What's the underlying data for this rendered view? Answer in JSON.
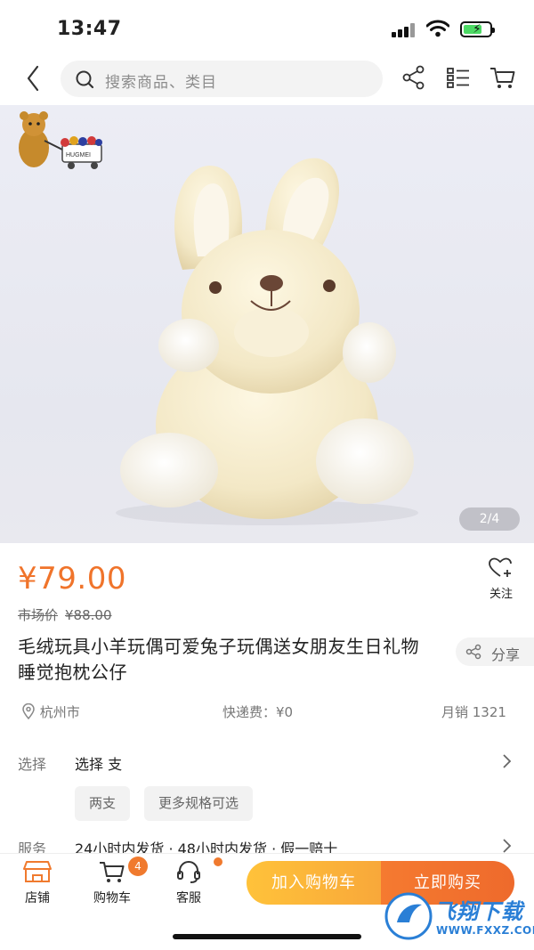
{
  "status_bar": {
    "time": "13:47"
  },
  "nav": {
    "search_placeholder": "搜索商品、类目"
  },
  "hero": {
    "counter": "2/4",
    "logo_text": "HUGMEI"
  },
  "product": {
    "price": "¥79.00",
    "market_label": "市场价",
    "market_price": "¥88.00",
    "follow_label": "关注",
    "title": "毛绒玩具小羊玩偶可爱兔子玩偶送女朋友生日礼物睡觉抱枕公仔",
    "share_label": "分享",
    "location": "杭州市",
    "shipping": "快递费：¥0",
    "monthly_sales": "月销 1321"
  },
  "options": {
    "select_label": "选择",
    "select_value": "选择 支",
    "chips": [
      "两支",
      "更多规格可选"
    ],
    "service_label": "服务",
    "service_value": "24小时内发货 · 48小时内发货 · 假一赔十"
  },
  "bottom_bar": {
    "store_label": "店铺",
    "cart_label": "购物车",
    "cart_badge": "4",
    "service_label": "客服",
    "add_to_cart": "加入购物车",
    "buy_now": "立即购买"
  },
  "watermark": {
    "title": "飞翔下载",
    "url": "WWW.FXXZ.COM"
  },
  "colors": {
    "accent": "#f0742b",
    "cart_button": "#ffc23a",
    "buy_button": "#f57a30"
  }
}
